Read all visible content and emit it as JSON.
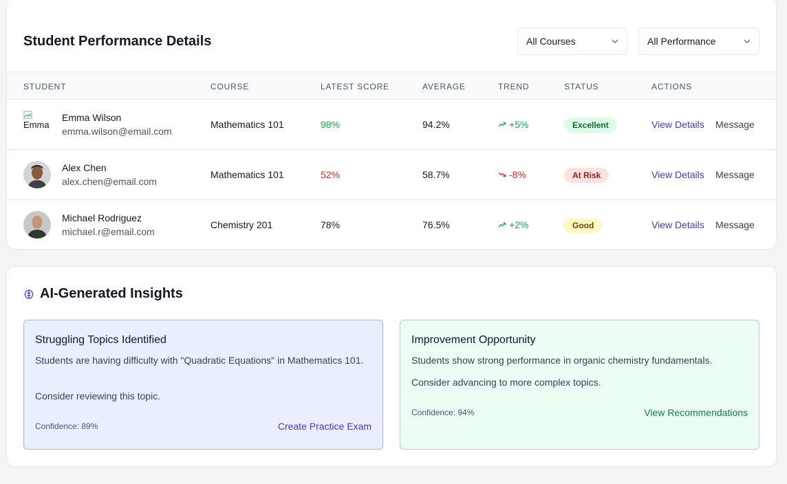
{
  "performance": {
    "title": "Student Performance Details",
    "filters": {
      "courses": "All Courses",
      "performance": "All Performance"
    },
    "columns": [
      "STUDENT",
      "COURSE",
      "LATEST SCORE",
      "AVERAGE",
      "TREND",
      "STATUS",
      "ACTIONS"
    ],
    "rows": [
      {
        "name": "Emma Wilson",
        "email": "emma.wilson@email.com",
        "avatar_alt": "Emma",
        "course": "Mathematics 101",
        "score": "98%",
        "average": "94.2%",
        "trend": "+5%",
        "trend_dir": "up",
        "status": "Excellent",
        "details_label": "View Details",
        "message_label": "Message"
      },
      {
        "name": "Alex Chen",
        "email": "alex.chen@email.com",
        "course": "Mathematics 101",
        "score": "52%",
        "average": "58.7%",
        "trend": "-8%",
        "trend_dir": "down",
        "status": "At Risk",
        "details_label": "View Details",
        "message_label": "Message"
      },
      {
        "name": "Michael Rodriguez",
        "email": "michael.r@email.com",
        "course": "Chemistry 201",
        "score": "78%",
        "average": "76.5%",
        "trend": "+2%",
        "trend_dir": "up",
        "status": "Good",
        "details_label": "View Details",
        "message_label": "Message"
      }
    ]
  },
  "insights": {
    "title": "AI-Generated Insights",
    "icon": "brain-icon",
    "cards": [
      {
        "title": "Struggling Topics Identified",
        "text1": "Students are having difficulty with \"Quadratic Equations\" in Mathematics 101.",
        "text2": "Consider reviewing this topic.",
        "confidence": "Confidence: 89%",
        "action": "Create Practice Exam"
      },
      {
        "title": "Improvement Opportunity",
        "text1": "Students show strong performance in organic chemistry fundamentals.",
        "text2": "Consider advancing to more complex topics.",
        "confidence": "Confidence: 94%",
        "action": "View Recommendations"
      }
    ]
  },
  "colors": {
    "accent": "#4338ca",
    "score_high": "#16a34a",
    "score_low": "#dc2626",
    "badge_excellent_bg": "#dcfce7",
    "badge_excellent_fg": "#166534",
    "badge_risk_bg": "#fee2e2",
    "badge_risk_fg": "#991b1b",
    "badge_good_bg": "#fef9c3",
    "badge_good_fg": "#713f12"
  }
}
